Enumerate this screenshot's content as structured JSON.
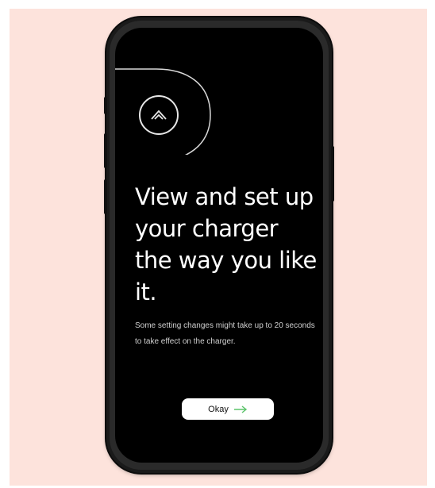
{
  "screen": {
    "logo_icon": "charger-brand-logo-icon",
    "headline": "View and set up your charger the way you like it.",
    "subtext": "Some setting changes might take up to 20 seconds to take effect on the charger.",
    "button_label": "Okay",
    "button_icon": "arrow-right-icon"
  },
  "colors": {
    "background": "#fde3dc",
    "screen": "#000000",
    "text": "#ffffff",
    "button": "#ffffff",
    "arrow_accent": "#5bc36a"
  }
}
